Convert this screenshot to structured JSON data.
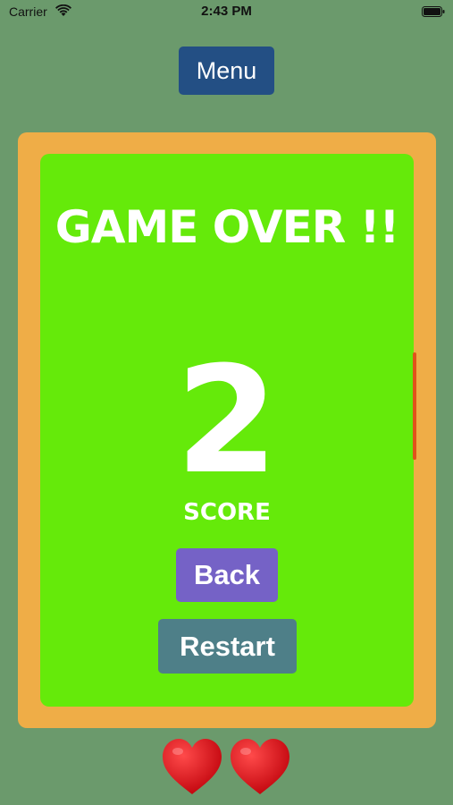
{
  "status_bar": {
    "carrier": "Carrier",
    "time": "2:43 PM",
    "wifi_icon": "wifi-icon",
    "battery_icon": "battery-icon"
  },
  "menu": {
    "label": "Menu"
  },
  "game_over": {
    "title": "GAME OVER !!",
    "score_value": "2",
    "score_label": "SCORE",
    "back_label": "Back",
    "restart_label": "Restart"
  },
  "lives": {
    "count": 2,
    "icon": "heart-icon"
  },
  "colors": {
    "background": "#6b9a6c",
    "menu_button": "#234f84",
    "frame": "#efad47",
    "board": "#65ea0a",
    "back_button": "#7562c6",
    "restart_button": "#4e7f88",
    "heart": "#e3131b"
  }
}
